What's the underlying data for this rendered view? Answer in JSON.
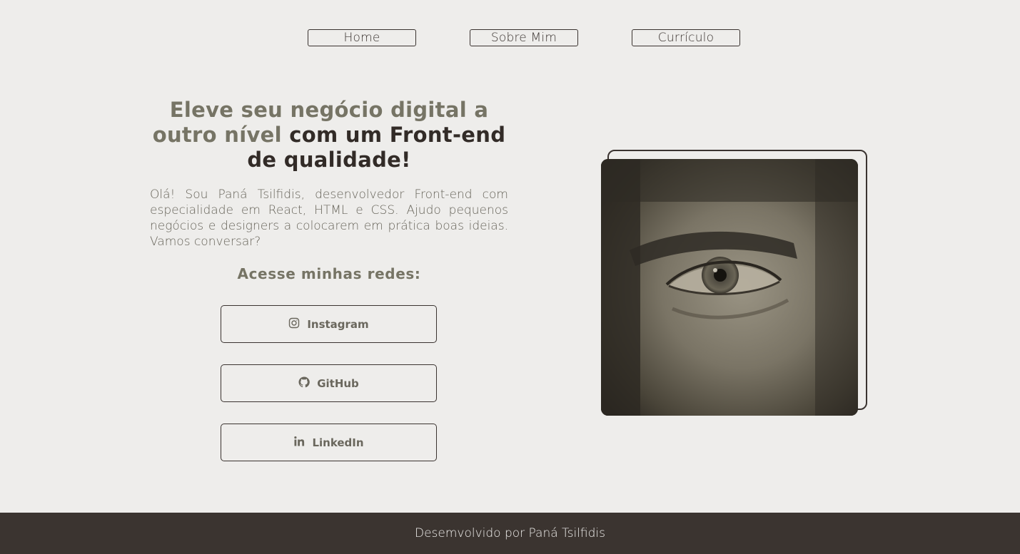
{
  "nav": {
    "items": [
      {
        "label": "Home"
      },
      {
        "label": "Sobre Mim"
      },
      {
        "label": "Currículo"
      }
    ]
  },
  "hero": {
    "headline_accent": "Eleve seu negócio digital a outro nível",
    "headline_dark": "com um Front-end de qualidade!",
    "intro": "Olá! Sou Paná Tsilfidis, desenvolvedor Front-end com especialidade em React, HTML e CSS. Ajudo pequenos negócios e designers a colocarem em prática boas ideias. Vamos conversar?",
    "social_title": "Acesse minhas redes:"
  },
  "social": {
    "links": [
      {
        "label": "Instagram",
        "icon": "instagram-icon"
      },
      {
        "label": "GitHub",
        "icon": "github-icon"
      },
      {
        "label": "LinkedIn",
        "icon": "linkedin-icon"
      }
    ]
  },
  "footer": {
    "text": "Desemvolvido por Paná Tsilfidis"
  },
  "colors": {
    "background": "#eeedeb",
    "accent": "#767465",
    "dark": "#322b27",
    "footer": "#3b3430"
  }
}
